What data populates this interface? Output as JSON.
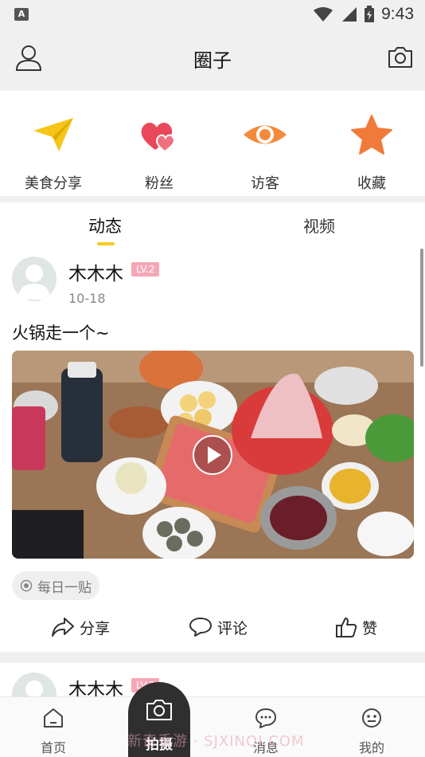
{
  "status": {
    "indicator_letter": "A",
    "time": "9:43",
    "icons": [
      "wifi-icon",
      "signal-icon",
      "battery-icon"
    ]
  },
  "header": {
    "title": "圈子",
    "left_icon": "user-icon",
    "right_icon": "camera-icon"
  },
  "quick_actions": [
    {
      "label": "美食分享",
      "icon": "paper-plane-icon",
      "color": "#f5c518"
    },
    {
      "label": "粉丝",
      "icon": "hearts-icon",
      "color": "#e8485a"
    },
    {
      "label": "访客",
      "icon": "eye-icon",
      "color": "#f28a3a"
    },
    {
      "label": "收藏",
      "icon": "star-icon",
      "color": "#f07a3a"
    }
  ],
  "tabs": [
    {
      "label": "动态",
      "active": true
    },
    {
      "label": "视频",
      "active": false
    }
  ],
  "posts": [
    {
      "username": "木木木",
      "level": "LV.2",
      "date": "10-18",
      "text": "火锅走一个~",
      "media": {
        "type": "video",
        "icon": "play-icon"
      },
      "tag": "每日一贴",
      "actions": {
        "share": "分享",
        "comment": "评论",
        "like": "赞"
      }
    },
    {
      "username": "木木木",
      "level": "LV.2"
    }
  ],
  "bottom_nav": [
    {
      "label": "首页",
      "icon": "home-icon"
    },
    {
      "label": "拍摄",
      "icon": "camera-icon"
    },
    {
      "label": "消息",
      "icon": "chat-icon"
    },
    {
      "label": "我的",
      "icon": "profile-icon"
    }
  ],
  "watermark": "新奇手游 · SJXINQI.COM",
  "colors": {
    "accent": "#f5cc1e",
    "level_badge": "#f6a7b6",
    "center_button": "#2f2f2f"
  }
}
